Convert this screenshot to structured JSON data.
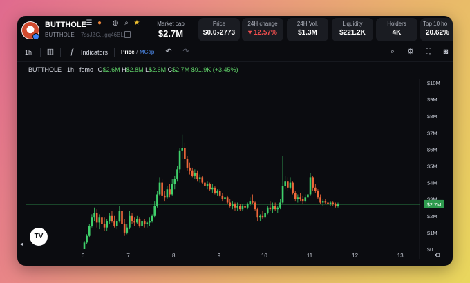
{
  "header": {
    "token_name": "BUTTHOLE",
    "token_sub": "BUTTHOLE",
    "address": "7ssJZG...gq46BL",
    "stats": [
      {
        "key": "mcap",
        "label": "Market cap",
        "value": "$2.7M"
      },
      {
        "key": "price",
        "label": "Price",
        "value": "$0.0₂2773"
      },
      {
        "key": "change",
        "label": "24H change",
        "value": "▾ 12.57%",
        "color": "#f04e4e"
      },
      {
        "key": "volume",
        "label": "24H Vol.",
        "value": "$1.3M"
      },
      {
        "key": "liquidity",
        "label": "Liquidity",
        "value": "$221.2K"
      },
      {
        "key": "holders",
        "label": "Holders",
        "value": "4K"
      },
      {
        "key": "top10",
        "label": "Top 10 ho",
        "value": "20.62%"
      }
    ]
  },
  "toolbar": {
    "interval": "1h",
    "indicators_label": "Indicators",
    "price_label": "Price",
    "toggle_sep": " / ",
    "mcap_label": "MCap"
  },
  "legend": {
    "symbol": "BUTTHOLE · 1h · fomo",
    "o_label": "O",
    "o_value": "$2.6M",
    "h_label": "H",
    "h_value": "$2.8M",
    "l_label": "L",
    "l_value": "$2.6M",
    "c_label": "C",
    "c_value": "$2.7M",
    "change": "$91.9K (+3.45%)"
  },
  "tv_logo": "TV",
  "colors": {
    "up": "#3fd06a",
    "down": "#f0683a",
    "accent": "#5fd068",
    "background": "#0b0c10"
  },
  "chart_data": {
    "type": "candlestick",
    "x_tick_labels": [
      "6",
      "7",
      "8",
      "9",
      "10",
      "11",
      "12",
      "13"
    ],
    "y_tick_labels": [
      "$0",
      "$1M",
      "$2M",
      "$3M",
      "$4M",
      "$5M",
      "$6M",
      "$7M",
      "$8M",
      "$9M",
      "$10M"
    ],
    "ylim": [
      0,
      10
    ],
    "y_unit": "$M",
    "x_days": [
      6,
      7,
      8,
      9,
      10,
      11,
      12,
      13
    ],
    "last_price_label": "$2.7M",
    "last_price": 2.7,
    "grid": false,
    "candles": [
      {
        "o": 0.0,
        "h": 0.5,
        "l": 0.0,
        "c": 0.4
      },
      {
        "o": 0.4,
        "h": 0.9,
        "l": 0.3,
        "c": 0.8
      },
      {
        "o": 0.8,
        "h": 1.5,
        "l": 0.7,
        "c": 1.4
      },
      {
        "o": 1.4,
        "h": 2.1,
        "l": 1.3,
        "c": 1.9
      },
      {
        "o": 1.9,
        "h": 2.5,
        "l": 1.7,
        "c": 2.2
      },
      {
        "o": 2.2,
        "h": 2.4,
        "l": 1.3,
        "c": 1.6
      },
      {
        "o": 1.6,
        "h": 2.1,
        "l": 1.2,
        "c": 1.9
      },
      {
        "o": 1.9,
        "h": 2.2,
        "l": 1.4,
        "c": 1.5
      },
      {
        "o": 1.5,
        "h": 1.9,
        "l": 1.1,
        "c": 1.3
      },
      {
        "o": 1.3,
        "h": 1.8,
        "l": 1.1,
        "c": 1.7
      },
      {
        "o": 1.7,
        "h": 2.2,
        "l": 1.5,
        "c": 2.0
      },
      {
        "o": 2.0,
        "h": 2.3,
        "l": 1.6,
        "c": 1.7
      },
      {
        "o": 1.7,
        "h": 2.0,
        "l": 1.3,
        "c": 1.4
      },
      {
        "o": 1.4,
        "h": 1.8,
        "l": 1.2,
        "c": 1.7
      },
      {
        "o": 1.7,
        "h": 2.6,
        "l": 1.6,
        "c": 2.3
      },
      {
        "o": 2.3,
        "h": 2.4,
        "l": 1.3,
        "c": 1.5
      },
      {
        "o": 1.5,
        "h": 1.8,
        "l": 0.8,
        "c": 1.0
      },
      {
        "o": 1.0,
        "h": 1.5,
        "l": 0.9,
        "c": 1.3
      },
      {
        "o": 1.3,
        "h": 2.3,
        "l": 1.2,
        "c": 2.0
      },
      {
        "o": 2.0,
        "h": 2.2,
        "l": 1.5,
        "c": 1.7
      },
      {
        "o": 1.7,
        "h": 1.9,
        "l": 1.4,
        "c": 1.6
      },
      {
        "o": 1.6,
        "h": 2.0,
        "l": 1.5,
        "c": 1.8
      },
      {
        "o": 1.8,
        "h": 1.9,
        "l": 1.3,
        "c": 1.4
      },
      {
        "o": 1.4,
        "h": 1.8,
        "l": 1.3,
        "c": 1.7
      },
      {
        "o": 1.7,
        "h": 1.8,
        "l": 1.3,
        "c": 1.5
      },
      {
        "o": 1.5,
        "h": 1.7,
        "l": 1.3,
        "c": 1.6
      },
      {
        "o": 1.6,
        "h": 1.9,
        "l": 1.4,
        "c": 1.7
      },
      {
        "o": 1.7,
        "h": 2.1,
        "l": 1.6,
        "c": 2.0
      },
      {
        "o": 2.0,
        "h": 2.9,
        "l": 1.9,
        "c": 2.6
      },
      {
        "o": 2.6,
        "h": 3.5,
        "l": 2.5,
        "c": 3.3
      },
      {
        "o": 3.3,
        "h": 4.3,
        "l": 3.2,
        "c": 4.0
      },
      {
        "o": 4.0,
        "h": 4.2,
        "l": 3.0,
        "c": 3.2
      },
      {
        "o": 3.2,
        "h": 3.5,
        "l": 2.9,
        "c": 3.1
      },
      {
        "o": 3.1,
        "h": 3.8,
        "l": 3.0,
        "c": 3.6
      },
      {
        "o": 3.6,
        "h": 3.9,
        "l": 3.1,
        "c": 3.3
      },
      {
        "o": 3.3,
        "h": 4.2,
        "l": 3.2,
        "c": 3.9
      },
      {
        "o": 3.9,
        "h": 4.4,
        "l": 3.6,
        "c": 4.2
      },
      {
        "o": 4.2,
        "h": 5.0,
        "l": 4.1,
        "c": 4.8
      },
      {
        "o": 4.8,
        "h": 6.1,
        "l": 4.6,
        "c": 5.9
      },
      {
        "o": 5.9,
        "h": 6.9,
        "l": 5.4,
        "c": 6.1
      },
      {
        "o": 6.1,
        "h": 6.4,
        "l": 5.2,
        "c": 5.4
      },
      {
        "o": 5.4,
        "h": 5.6,
        "l": 4.7,
        "c": 4.9
      },
      {
        "o": 4.9,
        "h": 5.2,
        "l": 4.5,
        "c": 4.7
      },
      {
        "o": 4.7,
        "h": 4.9,
        "l": 4.3,
        "c": 4.4
      },
      {
        "o": 4.4,
        "h": 4.8,
        "l": 4.2,
        "c": 4.6
      },
      {
        "o": 4.6,
        "h": 4.7,
        "l": 4.1,
        "c": 4.2
      },
      {
        "o": 4.2,
        "h": 4.5,
        "l": 4.0,
        "c": 4.3
      },
      {
        "o": 4.3,
        "h": 4.4,
        "l": 3.9,
        "c": 4.0
      },
      {
        "o": 4.0,
        "h": 4.2,
        "l": 3.6,
        "c": 3.8
      },
      {
        "o": 3.8,
        "h": 4.1,
        "l": 3.6,
        "c": 3.9
      },
      {
        "o": 3.9,
        "h": 4.0,
        "l": 3.5,
        "c": 3.6
      },
      {
        "o": 3.6,
        "h": 3.9,
        "l": 3.4,
        "c": 3.7
      },
      {
        "o": 3.7,
        "h": 3.8,
        "l": 3.3,
        "c": 3.4
      },
      {
        "o": 3.4,
        "h": 3.6,
        "l": 3.2,
        "c": 3.5
      },
      {
        "o": 3.5,
        "h": 3.6,
        "l": 3.1,
        "c": 3.2
      },
      {
        "o": 3.2,
        "h": 3.4,
        "l": 2.9,
        "c": 3.0
      },
      {
        "o": 3.0,
        "h": 3.3,
        "l": 2.8,
        "c": 3.1
      },
      {
        "o": 3.1,
        "h": 3.2,
        "l": 2.7,
        "c": 2.8
      },
      {
        "o": 2.8,
        "h": 3.0,
        "l": 2.5,
        "c": 2.6
      },
      {
        "o": 2.6,
        "h": 2.9,
        "l": 2.4,
        "c": 2.7
      },
      {
        "o": 2.7,
        "h": 2.8,
        "l": 2.3,
        "c": 2.5
      },
      {
        "o": 2.5,
        "h": 2.8,
        "l": 2.3,
        "c": 2.6
      },
      {
        "o": 2.6,
        "h": 2.7,
        "l": 2.3,
        "c": 2.4
      },
      {
        "o": 2.4,
        "h": 2.7,
        "l": 2.3,
        "c": 2.6
      },
      {
        "o": 2.6,
        "h": 2.8,
        "l": 2.4,
        "c": 2.5
      },
      {
        "o": 2.5,
        "h": 2.8,
        "l": 2.4,
        "c": 2.7
      },
      {
        "o": 2.7,
        "h": 3.1,
        "l": 2.6,
        "c": 2.9
      },
      {
        "o": 2.9,
        "h": 3.3,
        "l": 2.7,
        "c": 2.8
      },
      {
        "o": 2.8,
        "h": 2.9,
        "l": 2.3,
        "c": 2.4
      },
      {
        "o": 2.4,
        "h": 2.5,
        "l": 1.7,
        "c": 1.9
      },
      {
        "o": 1.9,
        "h": 2.1,
        "l": 1.7,
        "c": 2.0
      },
      {
        "o": 2.0,
        "h": 2.3,
        "l": 1.8,
        "c": 1.9
      },
      {
        "o": 1.9,
        "h": 2.4,
        "l": 1.8,
        "c": 2.2
      },
      {
        "o": 2.2,
        "h": 2.6,
        "l": 2.1,
        "c": 2.5
      },
      {
        "o": 2.5,
        "h": 2.9,
        "l": 2.3,
        "c": 2.4
      },
      {
        "o": 2.4,
        "h": 2.8,
        "l": 2.2,
        "c": 2.6
      },
      {
        "o": 2.6,
        "h": 2.8,
        "l": 2.3,
        "c": 2.4
      },
      {
        "o": 2.4,
        "h": 2.6,
        "l": 2.2,
        "c": 2.5
      },
      {
        "o": 2.5,
        "h": 3.0,
        "l": 2.4,
        "c": 2.8
      },
      {
        "o": 2.8,
        "h": 5.6,
        "l": 2.7,
        "c": 3.8
      },
      {
        "o": 3.8,
        "h": 4.4,
        "l": 3.6,
        "c": 4.1
      },
      {
        "o": 4.1,
        "h": 4.3,
        "l": 3.5,
        "c": 3.7
      },
      {
        "o": 3.7,
        "h": 4.3,
        "l": 3.6,
        "c": 4.0
      },
      {
        "o": 4.0,
        "h": 4.1,
        "l": 3.3,
        "c": 3.4
      },
      {
        "o": 3.4,
        "h": 3.5,
        "l": 2.9,
        "c": 3.0
      },
      {
        "o": 3.0,
        "h": 3.3,
        "l": 2.8,
        "c": 3.1
      },
      {
        "o": 3.1,
        "h": 3.4,
        "l": 2.9,
        "c": 3.0
      },
      {
        "o": 3.0,
        "h": 3.2,
        "l": 2.7,
        "c": 2.9
      },
      {
        "o": 2.9,
        "h": 3.3,
        "l": 2.8,
        "c": 3.1
      },
      {
        "o": 3.1,
        "h": 3.5,
        "l": 2.9,
        "c": 3.3
      },
      {
        "o": 3.3,
        "h": 4.6,
        "l": 3.2,
        "c": 4.3
      },
      {
        "o": 4.3,
        "h": 4.4,
        "l": 3.5,
        "c": 3.7
      },
      {
        "o": 3.7,
        "h": 3.9,
        "l": 3.4,
        "c": 3.5
      },
      {
        "o": 3.5,
        "h": 3.6,
        "l": 3.0,
        "c": 3.1
      },
      {
        "o": 3.1,
        "h": 3.3,
        "l": 2.7,
        "c": 2.8
      },
      {
        "o": 2.8,
        "h": 3.0,
        "l": 2.6,
        "c": 2.9
      },
      {
        "o": 2.9,
        "h": 3.0,
        "l": 2.7,
        "c": 2.8
      },
      {
        "o": 2.8,
        "h": 2.9,
        "l": 2.6,
        "c": 2.7
      },
      {
        "o": 2.7,
        "h": 2.9,
        "l": 2.6,
        "c": 2.8
      },
      {
        "o": 2.8,
        "h": 2.9,
        "l": 2.6,
        "c": 2.7
      },
      {
        "o": 2.7,
        "h": 2.8,
        "l": 2.5,
        "c": 2.6
      },
      {
        "o": 2.6,
        "h": 2.8,
        "l": 2.5,
        "c": 2.7
      }
    ]
  }
}
